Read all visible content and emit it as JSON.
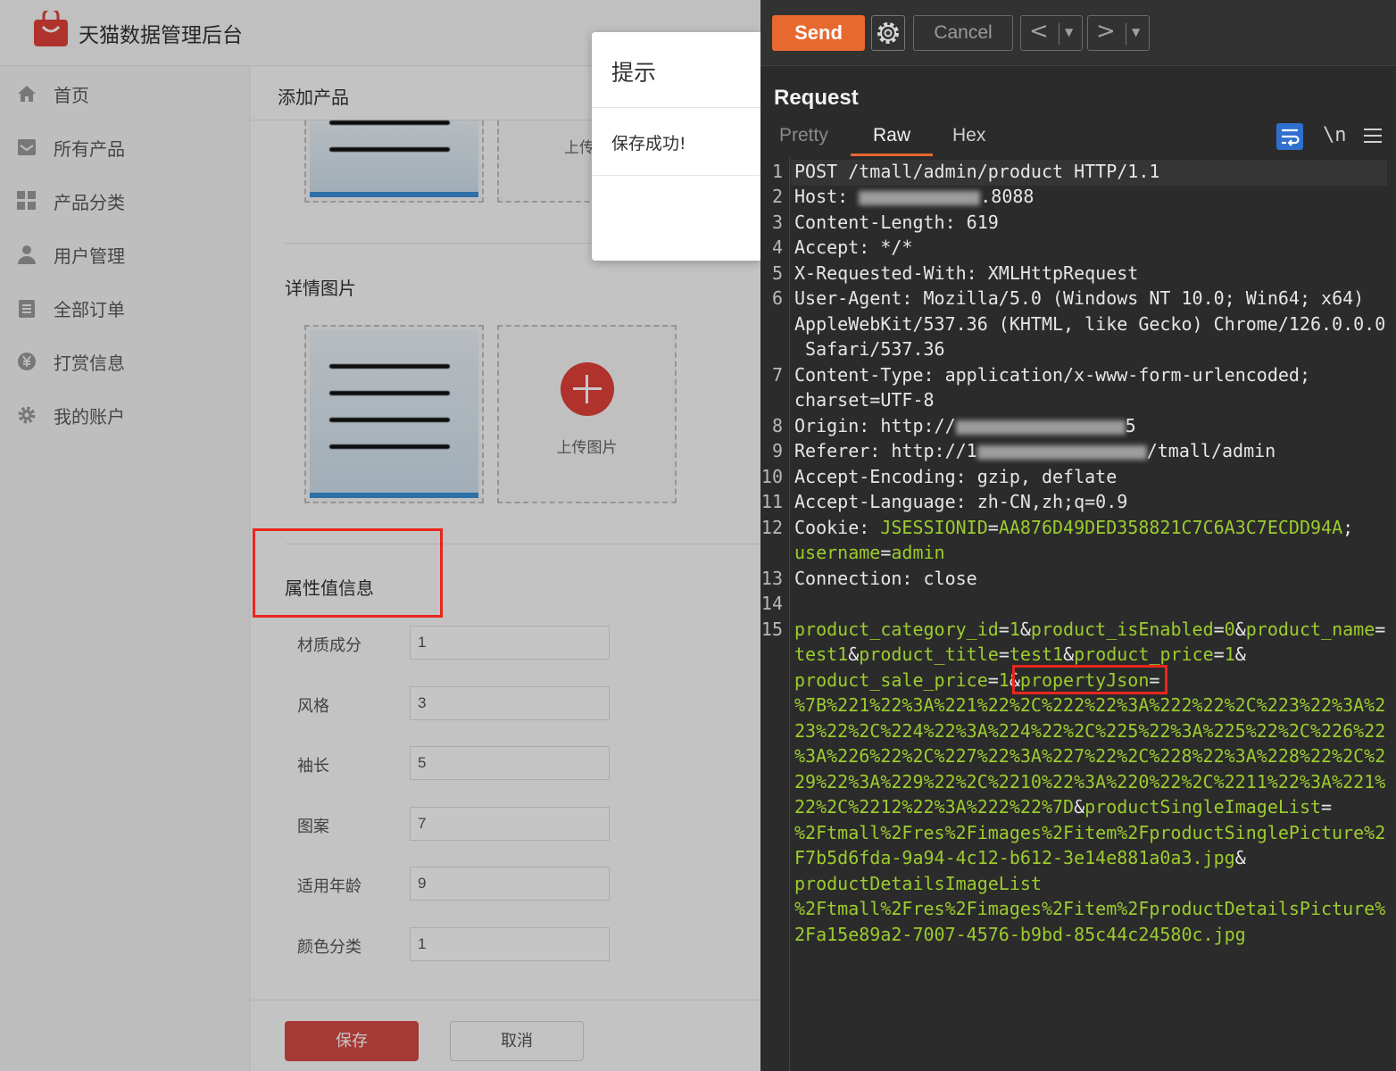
{
  "admin": {
    "app_title": "天猫数据管理后台",
    "sidebar": [
      {
        "label": "首页",
        "icon": "home-icon"
      },
      {
        "label": "所有产品",
        "icon": "inbox-icon"
      },
      {
        "label": "产品分类",
        "icon": "grid-icon"
      },
      {
        "label": "用户管理",
        "icon": "user-icon"
      },
      {
        "label": "全部订单",
        "icon": "clipboard-icon"
      },
      {
        "label": "打赏信息",
        "icon": "yen-coin-icon"
      },
      {
        "label": "我的账户",
        "icon": "gear-icon"
      }
    ],
    "page_title": "添加产品",
    "upload_label": "上传图片",
    "upload_label_partial": "上传图",
    "details_title": "详情图片",
    "attr_title": "属性值信息",
    "attributes": [
      {
        "name": "材质成分",
        "value": "1"
      },
      {
        "name": "风格",
        "value": "3"
      },
      {
        "name": "袖长",
        "value": "5"
      },
      {
        "name": "图案",
        "value": "7"
      },
      {
        "name": "适用年龄",
        "value": "9"
      },
      {
        "name": "颜色分类",
        "value": "1"
      }
    ],
    "save_label": "保存",
    "cancel_label": "取消",
    "modal": {
      "title": "提示",
      "message": "保存成功!"
    }
  },
  "burp": {
    "send_label": "Send",
    "cancel_label": "Cancel",
    "prev_label": "<",
    "next_label": ">",
    "section_title": "Request",
    "tabs": [
      "Pretty",
      "Raw",
      "Hex"
    ],
    "active_tab": "Raw",
    "newline_toggle": "\\n",
    "line_numbers": [
      "1",
      "2",
      "3",
      "4",
      "5",
      "6",
      "7",
      "8",
      "9",
      "10",
      "11",
      "12",
      "13",
      "14",
      "15"
    ],
    "request": {
      "l1": "POST /tmall/admin/product HTTP/1.1",
      "l2_key": "Host",
      "l2_val": ".8088",
      "l3_key": "Content-Length",
      "l3_val": "619",
      "l4_key": "Accept",
      "l4_val": "*/*",
      "l5_key": "X-Requested-With",
      "l5_val": "XMLHttpRequest",
      "l6_key": "User-Agent",
      "l6_val_a": "Mozilla/5.0 (Windows NT 10.0; Win64; x64)",
      "l6_val_b": "AppleWebKit/537.36 (KHTML, like Gecko) Chrome/126.0.0.0",
      "l6_val_c": " Safari/537.36",
      "l7_key": "Content-Type",
      "l7_val_a": "application/x-www-form-urlencoded;",
      "l7_val_b": "charset=UTF-8",
      "l8_key": "Origin",
      "l8_val": "http://",
      "l8_tail": "5",
      "l9_key": "Referer",
      "l9_val": "http://1",
      "l9_tail": "/tmall/admin",
      "l10_key": "Accept-Encoding",
      "l10_val": "gzip, deflate",
      "l11_key": "Accept-Language",
      "l11_val": "zh-CN,zh;q=0.9",
      "l12_key": "Cookie",
      "l12_c1k": "JSESSIONID",
      "l12_c1v": "AA876D49DED358821C7C6A3C7ECDD94A",
      "l12_c2k": "username",
      "l12_c2v": "admin",
      "l13_key": "Connection",
      "l13_val": "close",
      "body": [
        [
          "product_category_id",
          "1"
        ],
        [
          "product_isEnabled",
          "0"
        ],
        [
          "product_name",
          "test1"
        ],
        [
          "product_title",
          "test1"
        ],
        [
          "product_price",
          "1"
        ],
        [
          "product_sale_price",
          "1"
        ]
      ],
      "property_key": "propertyJson",
      "property_val_lines": [
        "%7B%221%22%3A%221%22%2C%222%22%3A%222%22%2C%223%22%3A%2",
        "23%22%2C%224%22%3A%224%22%2C%225%22%3A%225%22%2C%226%22",
        "%3A%226%22%2C%227%22%3A%227%22%2C%228%22%3A%228%22%2C%2",
        "29%22%3A%229%22%2C%2210%22%3A%220%22%2C%2211%22%3A%221%",
        "22%2C%2212%22%3A%222%22%7D"
      ],
      "single_key": "productSingleImageList",
      "single_val_lines": [
        "%2Ftmall%2Fres%2Fimages%2Fitem%2FproductSinglePicture%2",
        "F7b5d6fda-9a94-4c12-b612-3e14e881a0a3.jpg"
      ],
      "details_key": "productDetailsImageList",
      "details_val_lines": [
        "%2Ftmall%2Fres%2Fimages%2Fitem%2FproductDetailsPicture%",
        "2Fa15e89a2-7007-4576-b9bd-85c44c24580c.jpg"
      ]
    }
  }
}
